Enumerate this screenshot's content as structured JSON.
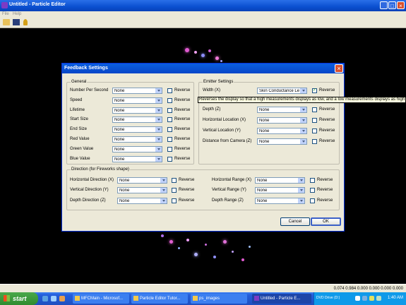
{
  "window": {
    "title": "Untitled - Particle Editor"
  },
  "menu": [
    "File",
    "Help"
  ],
  "status": {
    "text": "0.074 0.984 0.000 0.000 0.000 0.000"
  },
  "taskbar": {
    "start": "start",
    "tasks": [
      "MFCMain - Microsof...",
      "Particle Editor Tutor...",
      "ps_images",
      "Untitled - Particle E..."
    ],
    "tray_label": "DVD Drive (D:)",
    "clock": "1:40 AM"
  },
  "dialog": {
    "title": "Feedback Settings",
    "general": {
      "label": "General",
      "rows": [
        {
          "label": "Number Per Second",
          "value": "None",
          "reverse": "Reverse"
        },
        {
          "label": "Speed",
          "value": "None",
          "reverse": "Reverse"
        },
        {
          "label": "Lifetime",
          "value": "None",
          "reverse": "Reverse"
        },
        {
          "label": "Start Size",
          "value": "None",
          "reverse": "Reverse"
        },
        {
          "label": "End Size",
          "value": "None",
          "reverse": "Reverse"
        },
        {
          "label": "Red Value",
          "value": "None",
          "reverse": "Reverse"
        },
        {
          "label": "Green Value",
          "value": "None",
          "reverse": "Reverse"
        },
        {
          "label": "Blue Value",
          "value": "None",
          "reverse": "Reverse"
        }
      ]
    },
    "emitter": {
      "label": "Emitter Settings",
      "rows": [
        {
          "label": "Width (X)",
          "value": "Skin Conductance Lev",
          "reverse": "Reverse",
          "checked": true
        },
        {
          "label": "Depth (Z)",
          "value": "None",
          "reverse": "Reverse"
        },
        {
          "label": "Horizontal Location (X)",
          "value": "None",
          "reverse": "Reverse"
        },
        {
          "label": "Vertical Location (Y)",
          "value": "None",
          "reverse": "Reverse"
        },
        {
          "label": "Distance from Camera (Z)",
          "value": "None",
          "reverse": "Reverse"
        }
      ]
    },
    "tooltip": "Reverses the display so that a high measurements displays as low, and a low measurements displays as high",
    "direction": {
      "label": "Direction (for Fireworks shape)",
      "left": [
        {
          "label": "Horizontal Direction (X)",
          "value": "None",
          "reverse": "Reverse"
        },
        {
          "label": "Vertical Direction (Y)",
          "value": "None",
          "reverse": "Reverse"
        },
        {
          "label": "Depth Direction (Z)",
          "value": "None",
          "reverse": "Reverse"
        }
      ],
      "right": [
        {
          "label": "Horizontal Range (X)",
          "value": "None",
          "reverse": "Reverse"
        },
        {
          "label": "Vertical Range (Y)",
          "value": "None",
          "reverse": "Reverse"
        },
        {
          "label": "Depth Range (Z)",
          "value": "None",
          "reverse": "Reverse"
        }
      ]
    },
    "cancel": "Cancel",
    "ok": "OK"
  }
}
